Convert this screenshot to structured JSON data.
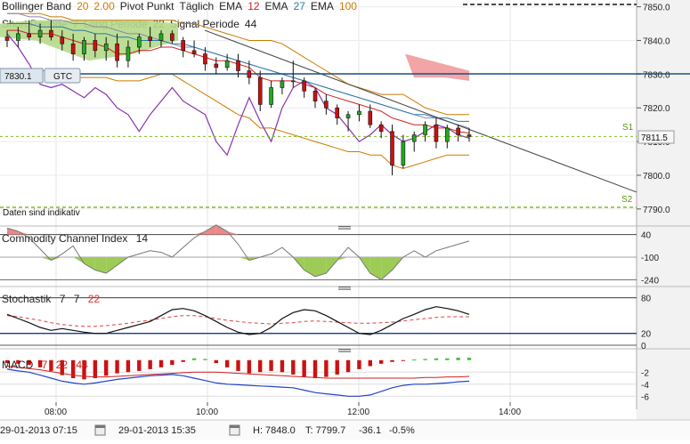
{
  "header": {
    "row1": [
      {
        "text": "Bollinger Band",
        "color": "#222222"
      },
      {
        "text": "20",
        "color": "#cc7a00"
      },
      {
        "text": "2.00",
        "color": "#cc7a00"
      },
      {
        "text": "Pivot Punkt",
        "color": "#222222"
      },
      {
        "text": "Täglich",
        "color": "#222222"
      },
      {
        "text": "EMA",
        "color": "#222222"
      },
      {
        "text": "12",
        "color": "#cc2222"
      },
      {
        "text": "EMA",
        "color": "#222222"
      },
      {
        "text": "27",
        "color": "#2a7aa8"
      },
      {
        "text": "EMA",
        "color": "#222222"
      },
      {
        "text": "100",
        "color": "#cc7a00"
      }
    ],
    "row2": [
      {
        "text": "Short Periode",
        "color": "#222222"
      },
      {
        "text": "7",
        "color": "#222222"
      },
      {
        "text": "Long Periode",
        "color": "#222222"
      },
      {
        "text": "22",
        "color": "#222222"
      },
      {
        "text": "Signal Periode",
        "color": "#222222"
      },
      {
        "text": "44",
        "color": "#222222"
      }
    ]
  },
  "order_bar": {
    "price": "7830.1",
    "type": "GTC"
  },
  "indicative_note": "Daten sind indikativ",
  "current_price_label": "7811.5",
  "pivot_labels": {
    "s1": "S1",
    "s2": "S2"
  },
  "panels": {
    "cci": {
      "name": "Commodity Channel Index",
      "param": "14",
      "ticks": [
        "40",
        "-100",
        "-240"
      ]
    },
    "stoch": {
      "name": "Stochastik",
      "params": [
        "7",
        "7",
        "22"
      ],
      "ticks": [
        "80",
        "20",
        "0"
      ]
    },
    "macd": {
      "name": "MACD",
      "params": [
        "7",
        "22",
        "44"
      ],
      "ticks": [
        "-2",
        "-4",
        "-6"
      ]
    }
  },
  "time_axis": [
    "08:00",
    "10:00",
    "12:00",
    "14:00"
  ],
  "footer": {
    "start": "29-01-2013 07:15",
    "end": "29-01-2013 15:35",
    "high": "H: 7848.0",
    "low": "T: 7799.7",
    "change": "-36.1",
    "change_pct": "-0.5%"
  },
  "colors": {
    "bull": "#22aa22",
    "bear": "#cc1111",
    "ema12": "#cc2222",
    "ema27": "#2a7aa8",
    "ema100": "#8888aa",
    "bollinger": "#cc7a00",
    "pivot": "#7bbf1f",
    "order_line": "#1a4f8a",
    "cci_line": "#777777",
    "cci_fill_pos": "#e88888",
    "cci_fill_neg": "#9ccc55",
    "stoch_k": "#111111",
    "stoch_d": "#dd4444",
    "macd_hist_neg": "#cc1111",
    "macd_hist_pos": "#44bb44",
    "macd_line": "#2244cc",
    "purple_line": "#8833aa",
    "cloud_green": "#b5d98a",
    "cloud_red": "#f0a0a0",
    "change": "#cc0000"
  },
  "chart_data": [
    {
      "type": "candlestick",
      "title": "",
      "x_ticks": [
        "08:00",
        "10:00",
        "12:00",
        "14:00"
      ],
      "ylim": [
        7786,
        7852
      ],
      "y_ticks": [
        7790,
        7800,
        7810,
        7820,
        7830,
        7840,
        7850
      ],
      "price_line": 7811.5,
      "order_level": 7830.1,
      "s1": 7811.5,
      "s2": 7790.5,
      "candles": [
        {
          "t": "07:15",
          "o": 7841,
          "h": 7843,
          "l": 7838,
          "c": 7840
        },
        {
          "t": "07:25",
          "o": 7840,
          "h": 7844,
          "l": 7838,
          "c": 7842
        },
        {
          "t": "07:35",
          "o": 7842,
          "h": 7846,
          "l": 7840,
          "c": 7841
        },
        {
          "t": "07:45",
          "o": 7841,
          "h": 7845,
          "l": 7839,
          "c": 7843
        },
        {
          "t": "07:55",
          "o": 7843,
          "h": 7846,
          "l": 7840,
          "c": 7841
        },
        {
          "t": "08:05",
          "o": 7841,
          "h": 7843,
          "l": 7837,
          "c": 7839
        },
        {
          "t": "08:15",
          "o": 7839,
          "h": 7842,
          "l": 7834,
          "c": 7836
        },
        {
          "t": "08:25",
          "o": 7836,
          "h": 7841,
          "l": 7834,
          "c": 7840
        },
        {
          "t": "08:35",
          "o": 7840,
          "h": 7842,
          "l": 7835,
          "c": 7837
        },
        {
          "t": "08:45",
          "o": 7837,
          "h": 7841,
          "l": 7834,
          "c": 7839
        },
        {
          "t": "08:55",
          "o": 7839,
          "h": 7842,
          "l": 7832,
          "c": 7834
        },
        {
          "t": "09:05",
          "o": 7834,
          "h": 7840,
          "l": 7832,
          "c": 7838
        },
        {
          "t": "09:15",
          "o": 7838,
          "h": 7842,
          "l": 7836,
          "c": 7841
        },
        {
          "t": "09:25",
          "o": 7841,
          "h": 7844,
          "l": 7838,
          "c": 7840
        },
        {
          "t": "09:35",
          "o": 7840,
          "h": 7843,
          "l": 7838,
          "c": 7842
        },
        {
          "t": "09:45",
          "o": 7842,
          "h": 7843,
          "l": 7839,
          "c": 7840
        },
        {
          "t": "09:55",
          "o": 7840,
          "h": 7841,
          "l": 7835,
          "c": 7837
        },
        {
          "t": "10:05",
          "o": 7837,
          "h": 7840,
          "l": 7835,
          "c": 7836
        },
        {
          "t": "10:15",
          "o": 7836,
          "h": 7838,
          "l": 7831,
          "c": 7833
        },
        {
          "t": "10:25",
          "o": 7833,
          "h": 7835,
          "l": 7830,
          "c": 7832
        },
        {
          "t": "10:35",
          "o": 7832,
          "h": 7836,
          "l": 7831,
          "c": 7834
        },
        {
          "t": "10:45",
          "o": 7834,
          "h": 7836,
          "l": 7829,
          "c": 7831
        },
        {
          "t": "10:55",
          "o": 7831,
          "h": 7834,
          "l": 7827,
          "c": 7829
        },
        {
          "t": "11:05",
          "o": 7829,
          "h": 7831,
          "l": 7819,
          "c": 7821
        },
        {
          "t": "11:15",
          "o": 7821,
          "h": 7828,
          "l": 7820,
          "c": 7826
        },
        {
          "t": "11:25",
          "o": 7826,
          "h": 7829,
          "l": 7824,
          "c": 7828
        },
        {
          "t": "11:35",
          "o": 7828,
          "h": 7834,
          "l": 7826,
          "c": 7828
        },
        {
          "t": "11:45",
          "o": 7828,
          "h": 7829,
          "l": 7823,
          "c": 7825
        },
        {
          "t": "11:55",
          "o": 7825,
          "h": 7826,
          "l": 7820,
          "c": 7822
        },
        {
          "t": "12:05",
          "o": 7822,
          "h": 7824,
          "l": 7818,
          "c": 7820
        },
        {
          "t": "12:15",
          "o": 7820,
          "h": 7821,
          "l": 7815,
          "c": 7817
        },
        {
          "t": "12:25",
          "o": 7817,
          "h": 7819,
          "l": 7813,
          "c": 7818
        },
        {
          "t": "12:35",
          "o": 7818,
          "h": 7821,
          "l": 7816,
          "c": 7819
        },
        {
          "t": "12:45",
          "o": 7819,
          "h": 7821,
          "l": 7814,
          "c": 7815
        },
        {
          "t": "12:55",
          "o": 7815,
          "h": 7816,
          "l": 7811,
          "c": 7813
        },
        {
          "t": "13:05",
          "o": 7813,
          "h": 7815,
          "l": 7800,
          "c": 7803
        },
        {
          "t": "13:15",
          "o": 7803,
          "h": 7812,
          "l": 7802,
          "c": 7810
        },
        {
          "t": "13:25",
          "o": 7810,
          "h": 7813,
          "l": 7807,
          "c": 7812
        },
        {
          "t": "13:35",
          "o": 7812,
          "h": 7816,
          "l": 7810,
          "c": 7815
        },
        {
          "t": "13:45",
          "o": 7815,
          "h": 7817,
          "l": 7808,
          "c": 7810
        },
        {
          "t": "13:55",
          "o": 7810,
          "h": 7815,
          "l": 7808,
          "c": 7814
        },
        {
          "t": "14:05",
          "o": 7814,
          "h": 7815,
          "l": 7810,
          "c": 7812
        },
        {
          "t": "14:15",
          "o": 7812,
          "h": 7814,
          "l": 7810,
          "c": 7811.5
        }
      ],
      "ema12": [
        7843,
        7843,
        7842,
        7842,
        7842,
        7841,
        7840,
        7839,
        7839,
        7838,
        7836,
        7836,
        7837,
        7837,
        7838,
        7838,
        7837,
        7836,
        7835,
        7834,
        7834,
        7833,
        7832,
        7829,
        7828,
        7828,
        7828,
        7827,
        7826,
        7824,
        7823,
        7822,
        7821,
        7820,
        7819,
        7817,
        7816,
        7815,
        7815,
        7814,
        7814,
        7813,
        7812.5
      ],
      "ema27": [
        7845,
        7845,
        7845,
        7844,
        7844,
        7844,
        7843,
        7843,
        7842,
        7842,
        7841,
        7841,
        7840,
        7840,
        7840,
        7839,
        7839,
        7838,
        7837,
        7836,
        7835,
        7834,
        7833,
        7832,
        7831,
        7830,
        7829,
        7828,
        7827,
        7826,
        7825,
        7824,
        7823,
        7822,
        7821,
        7820,
        7819,
        7818,
        7818,
        7817,
        7817,
        7816,
        7816
      ],
      "ema100": [
        7848,
        7848,
        7847,
        7847,
        7846,
        7846,
        7845,
        7845,
        7844,
        7844,
        7843,
        7842,
        7842,
        7841,
        7840,
        7839,
        7838,
        7838,
        7837,
        7836,
        7835,
        7834,
        7833,
        7832,
        7831,
        7830,
        7829,
        7828,
        7827,
        7826,
        7825,
        7824,
        7823,
        7822,
        7821,
        7820,
        7819,
        7818,
        7817,
        7817,
        7816,
        7815,
        7814
      ],
      "bb_upper": [
        7848,
        7848,
        7848,
        7848,
        7847,
        7847,
        7846,
        7846,
        7846,
        7846,
        7846,
        7846,
        7846,
        7846,
        7846,
        7846,
        7845,
        7845,
        7844,
        7843,
        7842,
        7841,
        7840,
        7840,
        7840,
        7839,
        7837,
        7835,
        7833,
        7831,
        7829,
        7827,
        7826,
        7825,
        7824,
        7824,
        7824,
        7822,
        7820,
        7819,
        7818,
        7818,
        7818
      ],
      "bb_lower": [
        7830,
        7830,
        7831,
        7831,
        7831,
        7830,
        7829,
        7829,
        7829,
        7829,
        7828,
        7828,
        7828,
        7829,
        7830,
        7830,
        7828,
        7826,
        7824,
        7822,
        7820,
        7818,
        7817,
        7814,
        7814,
        7813,
        7812,
        7811,
        7810,
        7809,
        7808,
        7807,
        7807,
        7806,
        7806,
        7803,
        7802,
        7803,
        7804,
        7805,
        7806,
        7806,
        7806
      ],
      "purple": [
        7842,
        7838,
        7833,
        7827,
        7826,
        7827,
        7825,
        7823,
        7826,
        7824,
        7820,
        7818,
        7813,
        7818,
        7822,
        7826,
        7822,
        7820,
        7818,
        7810,
        7806,
        7815,
        7823,
        7816,
        7810,
        7820,
        7826,
        7828,
        7826,
        7820,
        7818,
        7814,
        7810,
        7812,
        7815,
        7812,
        7810,
        7811,
        7813,
        7815,
        7814,
        7812,
        7811
      ]
    },
    {
      "type": "area",
      "title": "Commodity Channel Index",
      "ylim": [
        -260,
        60
      ],
      "y_ticks": [
        40,
        -100,
        -240
      ],
      "values": [
        80,
        60,
        20,
        -50,
        -120,
        -80,
        -30,
        -140,
        -180,
        -200,
        -150,
        -100,
        -80,
        -60,
        -70,
        -100,
        -40,
        20,
        60,
        100,
        60,
        -20,
        -120,
        -100,
        -80,
        -40,
        -100,
        -180,
        -220,
        -200,
        -120,
        -40,
        -100,
        -200,
        -240,
        -180,
        -100,
        -60,
        -100,
        -60,
        -40,
        -20,
        0
      ]
    },
    {
      "type": "line",
      "title": "Stochastik",
      "ylim": [
        0,
        90
      ],
      "y_ticks": [
        80,
        20,
        0
      ],
      "series": [
        {
          "name": "",
          "values": [
            52,
            45,
            38,
            30,
            25,
            28,
            25,
            22,
            20,
            20,
            25,
            30,
            35,
            40,
            50,
            60,
            62,
            58,
            50,
            40,
            30,
            22,
            18,
            20,
            30,
            45,
            55,
            60,
            58,
            50,
            40,
            30,
            20,
            18,
            25,
            35,
            45,
            52,
            60,
            65,
            62,
            58,
            52
          ]
        },
        {
          "name": "",
          "values": [
            50,
            48,
            45,
            42,
            38,
            35,
            33,
            32,
            32,
            33,
            35,
            37,
            40,
            42,
            45,
            48,
            50,
            50,
            48,
            45,
            42,
            40,
            38,
            37,
            36,
            37,
            38,
            40,
            41,
            40,
            39,
            38,
            37,
            37,
            38,
            39,
            41,
            43,
            45,
            47,
            48,
            48,
            48
          ]
        }
      ]
    },
    {
      "type": "bar",
      "title": "MACD",
      "ylim": [
        -7,
        1
      ],
      "y_ticks": [
        -2,
        -4,
        -6
      ],
      "histogram": [
        -0.5,
        -0.6,
        -0.8,
        -1.2,
        -1.8,
        -2.5,
        -3.0,
        -3.2,
        -3.0,
        -2.6,
        -2.2,
        -2.0,
        -1.8,
        -1.5,
        -1.2,
        -0.8,
        -0.3,
        0.3,
        0.2,
        -0.5,
        -1.2,
        -1.8,
        -2.2,
        -2.0,
        -1.8,
        -2.0,
        -2.4,
        -2.8,
        -3.0,
        -2.8,
        -2.4,
        -2.0,
        -1.5,
        -1.0,
        -0.6,
        -0.3,
        -0.1,
        0.1,
        0.2,
        0.3,
        0.3,
        0.4,
        0.4
      ],
      "signal": [
        -1.0,
        -1.2,
        -1.4,
        -1.6,
        -1.9,
        -2.2,
        -2.5,
        -2.7,
        -2.8,
        -2.8,
        -2.7,
        -2.6,
        -2.5,
        -2.4,
        -2.3,
        -2.2,
        -2.1,
        -2.0,
        -2.0,
        -2.0,
        -2.1,
        -2.2,
        -2.3,
        -2.4,
        -2.5,
        -2.6,
        -2.7,
        -2.8,
        -2.9,
        -3.0,
        -3.0,
        -3.0,
        -3.0,
        -3.0,
        -3.0,
        -3.0,
        -3.0,
        -3.0,
        -2.9,
        -2.9,
        -2.8,
        -2.8,
        -2.7
      ],
      "macd_line": [
        -1.5,
        -1.8,
        -2.0,
        -2.5,
        -3.0,
        -3.5,
        -3.8,
        -4.0,
        -3.8,
        -3.5,
        -3.2,
        -3.0,
        -2.8,
        -2.6,
        -2.5,
        -2.4,
        -2.6,
        -3.0,
        -3.4,
        -3.8,
        -4.0,
        -4.1,
        -4.2,
        -4.3,
        -4.4,
        -4.5,
        -4.6,
        -5.0,
        -5.4,
        -5.6,
        -5.8,
        -6.0,
        -6.0,
        -5.8,
        -5.2,
        -4.6,
        -4.2,
        -4.0,
        -4.0,
        -3.9,
        -3.8,
        -3.6,
        -3.5
      ]
    }
  ]
}
